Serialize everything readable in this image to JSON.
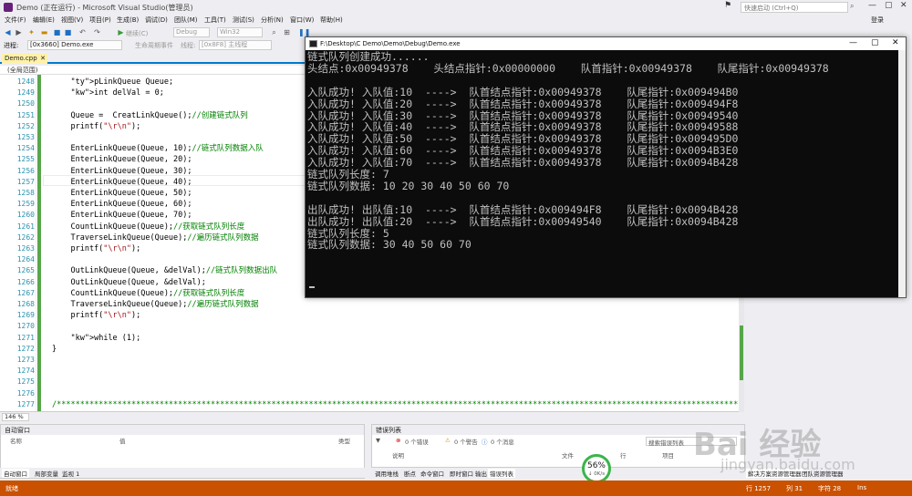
{
  "window": {
    "title": "Demo (正在运行) - Microsoft Visual Studio(管理员)",
    "quick_launch_placeholder": "快速启动 (Ctrl+Q)",
    "login": "登录"
  },
  "menu": [
    "文件(F)",
    "编辑(E)",
    "视图(V)",
    "项目(P)",
    "生成(B)",
    "调试(D)",
    "团队(M)",
    "工具(T)",
    "测试(S)",
    "分析(N)",
    "窗口(W)",
    "帮助(H)"
  ],
  "toolbar": {
    "config": "Debug",
    "platform": "Win32",
    "continue_label": "继续(C)",
    "process_label": "进程:",
    "process_value": "[0x3660] Demo.exe",
    "lifecycle_label": "生命周期事件",
    "thread_label": "线程:",
    "thread_value": "[0x8F8] 主线程"
  },
  "editor": {
    "tab": "Demo.cpp",
    "scope": "(全局范围)",
    "zoom": "146 %",
    "lines": [
      {
        "n": "1248",
        "code": "    pLinkQueue Queue;"
      },
      {
        "n": "1249",
        "code": "    int delVal = 0;"
      },
      {
        "n": "1250",
        "code": ""
      },
      {
        "n": "1251",
        "code": "    Queue =  CreatLinkQueue();//创建链式队列"
      },
      {
        "n": "1252",
        "code": "    printf(\"\\r\\n\");"
      },
      {
        "n": "1253",
        "code": ""
      },
      {
        "n": "1254",
        "code": "    EnterLinkQueue(Queue, 10);//链式队列数据入队"
      },
      {
        "n": "1255",
        "code": "    EnterLinkQueue(Queue, 20);"
      },
      {
        "n": "1256",
        "code": "    EnterLinkQueue(Queue, 30);"
      },
      {
        "n": "1257",
        "code": "    EnterLinkQueue(Queue, 40);"
      },
      {
        "n": "1258",
        "code": "    EnterLinkQueue(Queue, 50);"
      },
      {
        "n": "1259",
        "code": "    EnterLinkQueue(Queue, 60);"
      },
      {
        "n": "1260",
        "code": "    EnterLinkQueue(Queue, 70);"
      },
      {
        "n": "1261",
        "code": "    CountLinkQueue(Queue);//获取链式队列长度"
      },
      {
        "n": "1262",
        "code": "    TraverseLinkQueue(Queue);//遍历链式队列数据"
      },
      {
        "n": "1263",
        "code": "    printf(\"\\r\\n\");"
      },
      {
        "n": "1264",
        "code": ""
      },
      {
        "n": "1265",
        "code": "    OutLinkQueue(Queue, &delVal);//链式队列数据出队"
      },
      {
        "n": "1266",
        "code": "    OutLinkQueue(Queue, &delVal);"
      },
      {
        "n": "1267",
        "code": "    CountLinkQueue(Queue);//获取链式队列长度"
      },
      {
        "n": "1268",
        "code": "    TraverseLinkQueue(Queue);//遍历链式队列数据"
      },
      {
        "n": "1269",
        "code": "    printf(\"\\r\\n\");"
      },
      {
        "n": "1270",
        "code": ""
      },
      {
        "n": "1271",
        "code": "    while (1);"
      },
      {
        "n": "1272",
        "code": "}"
      },
      {
        "n": "1273",
        "code": ""
      },
      {
        "n": "1274",
        "code": ""
      },
      {
        "n": "1275",
        "code": ""
      },
      {
        "n": "1276",
        "code": ""
      },
      {
        "n": "1277",
        "code": "/***********************************************************************************************************************************************************************"
      }
    ]
  },
  "console": {
    "title": "F:\\Desktop\\C Demo\\Demo\\Debug\\Demo.exe",
    "lines": [
      "链式队列创建成功......",
      "头结点:0x00949378    头结点指针:0x00000000    队首指针:0x00949378    队尾指针:0x00949378",
      "",
      "入队成功! 入队值:10  ---->  队首结点指针:0x00949378    队尾指针:0x009494B0",
      "入队成功! 入队值:20  ---->  队首结点指针:0x00949378    队尾指针:0x009494F8",
      "入队成功! 入队值:30  ---->  队首结点指针:0x00949378    队尾指针:0x00949540",
      "入队成功! 入队值:40  ---->  队首结点指针:0x00949378    队尾指针:0x00949588",
      "入队成功! 入队值:50  ---->  队首结点指针:0x00949378    队尾指针:0x009495D0",
      "入队成功! 入队值:60  ---->  队首结点指针:0x00949378    队尾指针:0x0094B3E0",
      "入队成功! 入队值:70  ---->  队首结点指针:0x00949378    队尾指针:0x0094B428",
      "链式队列长度: 7",
      "链式队列数据: 10 20 30 40 50 60 70",
      "",
      "出队成功! 出队值:10  ---->  队首结点指针:0x009494F8    队尾指针:0x0094B428",
      "出队成功! 出队值:20  ---->  队首结点指针:0x00949540    队尾指针:0x0094B428",
      "链式队列长度: 5",
      "链式队列数据: 30 40 50 60 70"
    ]
  },
  "auto_window": {
    "title": "自动窗口",
    "col_name": "名称",
    "col_value": "值",
    "col_type": "类型",
    "tabs": [
      "自动窗口",
      "局部变量",
      "监视 1"
    ]
  },
  "error_list": {
    "title": "错误列表",
    "errors": "0 个错误",
    "warnings": "0 个警告",
    "messages": "0 个消息",
    "search_placeholder": "搜索错误列表",
    "col_desc": "说明",
    "col_file": "文件",
    "col_line": "行",
    "col_project": "项目",
    "tabs": [
      "调用堆栈",
      "断点",
      "命令窗口",
      "即时窗口",
      "输出",
      "错误列表"
    ]
  },
  "right_tabs": {
    "solution": "解决方案资源管理器",
    "team": "团队资源管理器"
  },
  "progress": {
    "percent": "56%",
    "speed": "↓ 0K/s",
    "value": 56
  },
  "status": {
    "ready": "就绪",
    "line": "行 1257",
    "col": "列 31",
    "char": "字符 28",
    "ins": "Ins"
  },
  "watermark": {
    "main": "Bai 经验",
    "sub": "jingyan.baidu.com"
  },
  "colors": {
    "accent": "#007acc",
    "status_bar": "#ca5100",
    "change_bar": "#57a64a"
  }
}
